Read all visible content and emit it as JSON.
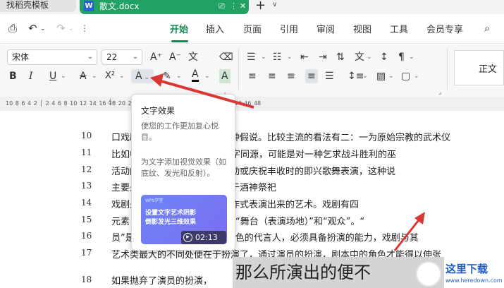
{
  "tabs": {
    "other_label": "找稻壳模板",
    "doc_icon": "W",
    "doc_label": "散文.docx",
    "monitor_icon": "monitor-icon",
    "more_icon": "more-icon",
    "close_icon": "close-icon",
    "plus": "+",
    "plus_dd": "∨"
  },
  "quick": {
    "icons": [
      "save-icon",
      "undo-icon",
      "redo-icon"
    ]
  },
  "menu": [
    "开始",
    "插入",
    "页面",
    "引用",
    "审阅",
    "视图",
    "工具",
    "会员专享"
  ],
  "font": {
    "family": "宋体",
    "size": "22"
  },
  "ribbon": {
    "style_label": "正文",
    "grow": "A⁺",
    "shrink": "A⁻",
    "clear": "⌫"
  },
  "format_buttons": {
    "bold": "B",
    "italic": "I",
    "underline": "U",
    "strike": "A",
    "superscript": "X²",
    "text_effect": "A",
    "highlight": "✎",
    "font_color": "A",
    "char_shade": "A"
  },
  "ruler": "10  8  6  4  2  │  2  4  6  8  10  12  14  16  18  20  22  24  26  28  30  32  34  36  38  40  42  44  46  48",
  "tooltip": {
    "title": "文字效果",
    "desc": "使您的工作更加复心悦目。",
    "desc2": "为文字添加视觉效果（如底纹、发光和反射）。",
    "video_brand": "WPS学堂",
    "video_caption": "设置文字艺术阴影\n倒影发光三维效果",
    "duration": "02:13"
  },
  "doc": {
    "line_numbers": [
      "10",
      "11",
      "12",
      "13",
      "14",
      "15",
      "16",
      "17",
      "18"
    ],
    "lines": [
      "口戏剧的起源众说纷纭，有多种假说。比较主流的看法有二：一为原始宗教的武术仪",
      "比如中国古代有“舞”、“武”三字同源，可能是对一种乞求战斗胜利的巫",
      "活动的艺术化形态。另一为劳动或庆祝丰收时的即兴歌舞表演，这种说",
      "主要是西方，它被认为是起源于酒神祭祀",
      "戏剧是一种以对话、歌唱或动作式表演出来的艺术。戏剧有四",
      "元素，包括了“故事（情境）”、“舞台（表演场地）”和“观众”。“",
      "员”是戏剧的表现元素，他是角色的代言人，必须具备扮演的能力，戏剧与其",
      "艺术类最大的不同处便在于扮演了，通过演员的扮演，剧本中的角色才能得以伸张",
      "如果抛弃了演员的扮演，"
    ],
    "big_text": "那么所演出的便不"
  },
  "logo": {
    "main": "这里下载",
    "sub": "www.heredown.com"
  }
}
